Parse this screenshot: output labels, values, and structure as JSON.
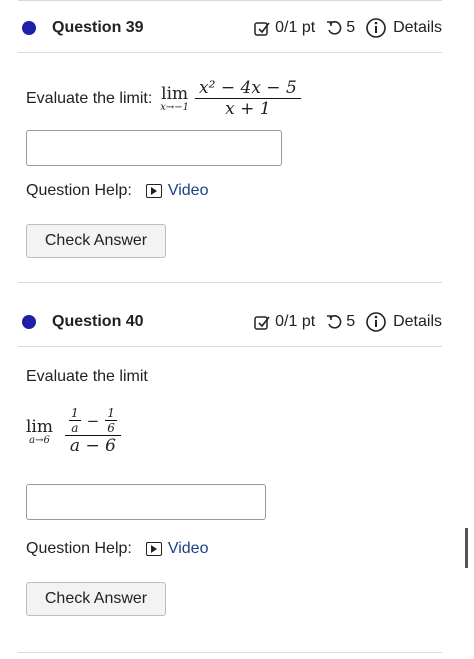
{
  "questions": [
    {
      "title": "Question 39",
      "score": "0/1 pt",
      "retries": "5",
      "details": "Details",
      "prompt": "Evaluate the limit:",
      "lim": {
        "word": "lim",
        "sub": "x→−1",
        "num": "x² − 4x − 5",
        "den": "x + 1"
      },
      "help_label": "Question Help:",
      "video_label": "Video",
      "check_label": "Check Answer"
    },
    {
      "title": "Question 40",
      "score": "0/1 pt",
      "retries": "5",
      "details": "Details",
      "prompt": "Evaluate the limit",
      "lim": {
        "word": "lim",
        "sub": "a→6",
        "num_a": {
          "n": "1",
          "d": "a"
        },
        "num_b": {
          "n": "1",
          "d": "6"
        },
        "minus": "−",
        "den": "a − 6"
      },
      "help_label": "Question Help:",
      "video_label": "Video",
      "check_label": "Check Answer"
    }
  ],
  "colors": {
    "dot": "#1f1fa8",
    "link": "#1d3e86"
  }
}
